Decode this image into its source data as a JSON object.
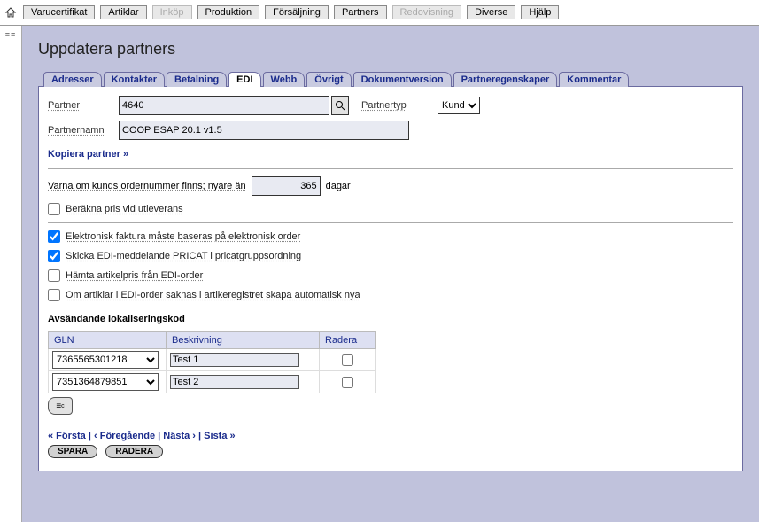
{
  "menu": {
    "items": [
      {
        "label": "Varucertifikat",
        "disabled": false
      },
      {
        "label": "Artiklar",
        "disabled": false
      },
      {
        "label": "Inköp",
        "disabled": true
      },
      {
        "label": "Produktion",
        "disabled": false
      },
      {
        "label": "Försäljning",
        "disabled": false
      },
      {
        "label": "Partners",
        "disabled": false
      },
      {
        "label": "Redovisning",
        "disabled": true
      },
      {
        "label": "Diverse",
        "disabled": false
      },
      {
        "label": "Hjälp",
        "disabled": false
      }
    ]
  },
  "page_title": "Uppdatera partners",
  "tabs": [
    {
      "label": "Adresser"
    },
    {
      "label": "Kontakter"
    },
    {
      "label": "Betalning"
    },
    {
      "label": "EDI",
      "active": true
    },
    {
      "label": "Webb"
    },
    {
      "label": "Övrigt"
    },
    {
      "label": "Dokumentversion"
    },
    {
      "label": "Partneregenskaper"
    },
    {
      "label": "Kommentar"
    }
  ],
  "form": {
    "partner_label": "Partner",
    "partner_value": "4640",
    "partnertyp_label": "Partnertyp",
    "partnertyp_value": "Kund",
    "partnernamn_label": "Partnernamn",
    "partnernamn_value": "COOP ESAP 20.1 v1.5",
    "copy_link": "Kopiera partner »",
    "days_prefix": "Varna om kunds ordernummer finns; nyare än",
    "days_value": "365",
    "days_suffix": "dagar",
    "checks": [
      {
        "label": "Beräkna pris vid utleverans",
        "checked": false
      },
      {
        "label": "Elektronisk faktura måste baseras på elektronisk order",
        "checked": true
      },
      {
        "label": "Skicka EDI-meddelande PRICAT i pricatgruppsordning",
        "checked": true
      },
      {
        "label": "Hämta artikelpris från EDI-order",
        "checked": false
      },
      {
        "label": "Om artiklar i EDI-order saknas i artikeregistret skapa automatisk nya",
        "checked": false
      }
    ],
    "section_title": "Avsändande lokaliseringskod",
    "grid": {
      "headers": {
        "gln": "GLN",
        "desc": "Beskrivning",
        "del": "Radera"
      },
      "rows": [
        {
          "gln": "7365565301218",
          "desc": "Test 1"
        },
        {
          "gln": "7351364879851",
          "desc": "Test 2"
        }
      ]
    }
  },
  "pager": {
    "first": "« Första",
    "prev": "‹ Föregående",
    "next": "Nästa ›",
    "last": "Sista »"
  },
  "actions": {
    "save": "SPARA",
    "delete": "RADERA"
  }
}
